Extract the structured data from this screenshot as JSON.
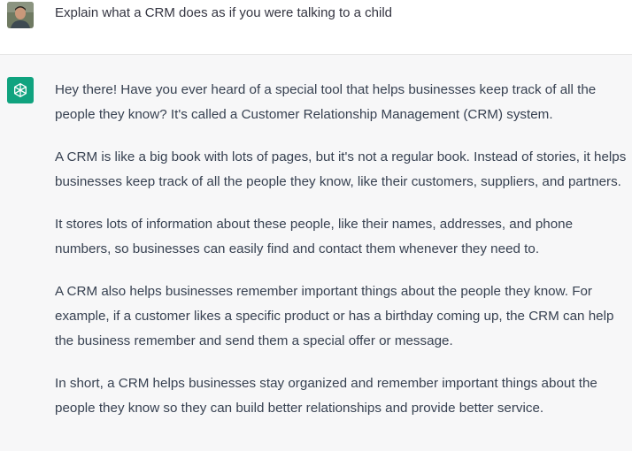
{
  "user_message": {
    "text": "Explain what a CRM does as if you were talking to a child",
    "avatar_icon": "user-photo-avatar"
  },
  "assistant_message": {
    "avatar_icon": "openai-logo-icon",
    "avatar_color": "#10a37f",
    "paragraphs": [
      "Hey there! Have you ever heard of a special tool that helps businesses keep track of all the people they know? It's called a Customer Relationship Management (CRM) system.",
      "A CRM is like a big book with lots of pages, but it's not a regular book. Instead of stories, it helps businesses keep track of all the people they know, like their customers, suppliers, and partners.",
      "It stores lots of information about these people, like their names, addresses, and phone numbers, so businesses can easily find and contact them whenever they need to.",
      "A CRM also helps businesses remember important things about the people they know. For example, if a customer likes a specific product or has a birthday coming up, the CRM can help the business remember and send them a special offer or message.",
      "In short, a CRM helps businesses stay organized and remember important things about the people they know so they can build better relationships and provide better service."
    ]
  }
}
